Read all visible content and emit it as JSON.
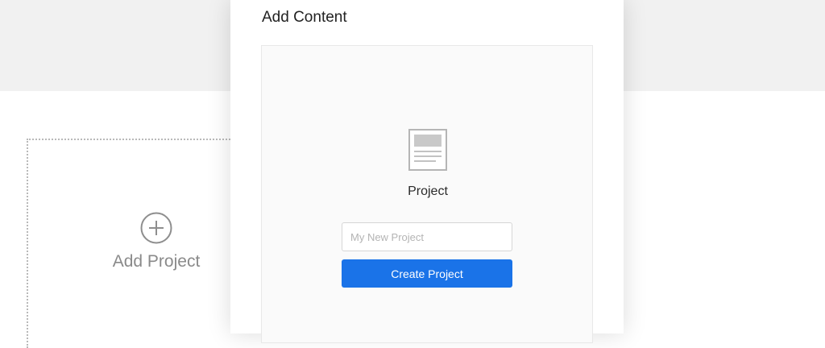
{
  "background": {
    "add_project_label": "Add Project",
    "add_project_icon": "plus-circle-icon"
  },
  "modal": {
    "title": "Add Content",
    "content_type": {
      "icon": "document-icon",
      "label": "Project"
    },
    "name_input": {
      "placeholder": "My New Project",
      "value": ""
    },
    "create_button_label": "Create Project"
  },
  "colors": {
    "primary_button": "#1a73e8",
    "top_band": "#f1f1f1",
    "muted_text": "#8a8a8a"
  }
}
